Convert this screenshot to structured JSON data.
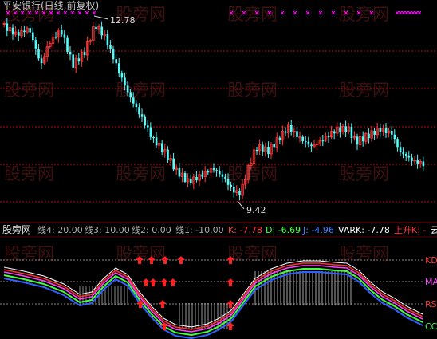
{
  "main_chart": {
    "title": "平安银行(日线,前复权)",
    "high_label": "12.78",
    "low_label": "9.42",
    "watermark": "股旁网",
    "colors": {
      "up": "#ff3b3b",
      "down": "#54fcfc",
      "grid": "#b01010",
      "title": "#c8c8c8",
      "markers": "#ff00ff"
    }
  },
  "indicator": {
    "logo": "股旁网",
    "params": [
      "线4: 20.00",
      "线3: 10.00",
      "线2: 0.00",
      "线1: -10.00"
    ],
    "values": [
      {
        "label": "K: -7.78",
        "color": "#ff4040"
      },
      {
        "label": "D: -6.69",
        "color": "#40ff40"
      },
      {
        "label": "J: -4.96",
        "color": "#4080ff"
      },
      {
        "label": "VARK: -7.78",
        "color": "#ffffff"
      },
      {
        "label": "上升K: -",
        "color": "#ff3030"
      },
      {
        "label": "云",
        "color": "#ffffff"
      }
    ],
    "right_labels": [
      {
        "label": "KD",
        "color": "#ff3030"
      },
      {
        "label": "MA",
        "color": "#ff40ff"
      },
      {
        "label": "RS",
        "color": "#ff3030"
      },
      {
        "label": "CC",
        "color": "#40ff40"
      }
    ],
    "colors": {
      "k": "#ff3030",
      "d": "#40ff40",
      "j": "#3060ff",
      "magenta": "#ff40ff",
      "white": "#ffffff",
      "arrow": "#ff2020"
    }
  }
}
